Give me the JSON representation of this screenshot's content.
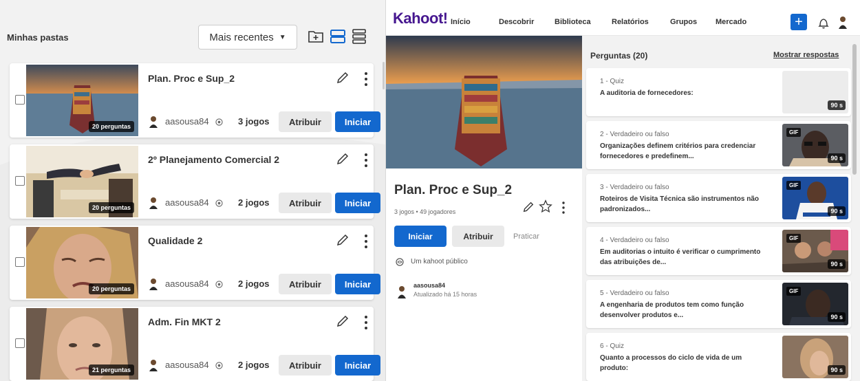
{
  "left": {
    "title": "Minhas pastas",
    "sort_label": "Mais recentes",
    "cards": [
      {
        "title": "Plan. Proc e Sup_2",
        "questions": "20 perguntas",
        "author": "aasousa84",
        "plays": "3 jogos",
        "assign": "Atribuir",
        "start": "Iniciar",
        "thumb": "ship"
      },
      {
        "title": "2º Planejamento Comercial 2",
        "questions": "20 perguntas",
        "author": "aasousa84",
        "plays": "2 jogos",
        "assign": "Atribuir",
        "start": "Iniciar",
        "thumb": "handshake"
      },
      {
        "title": "Qualidade 2",
        "questions": "20 perguntas",
        "author": "aasousa84",
        "plays": "2 jogos",
        "assign": "Atribuir",
        "start": "Iniciar",
        "thumb": "woman-crying"
      },
      {
        "title": "Adm. Fin MKT 2",
        "questions": "21 perguntas",
        "author": "aasousa84",
        "plays": "2 jogos",
        "assign": "Atribuir",
        "start": "Iniciar",
        "thumb": "woman-face"
      }
    ]
  },
  "nav": {
    "logo": "Kahoot!",
    "links": [
      "Início",
      "Descobrir",
      "Biblioteca",
      "Relatórios",
      "Grupos",
      "Mercado"
    ],
    "plus": "+"
  },
  "detail": {
    "title": "Plan. Proc e Sup_2",
    "meta": "3 jogos • 49 jogadores",
    "start": "Iniciar",
    "assign": "Atribuir",
    "practice": "Praticar",
    "visibility": "Um kahoot público",
    "creator": "aasousa84",
    "updated": "Atualizado há 15 horas"
  },
  "questions": {
    "header": "Perguntas (20)",
    "show_answers": "Mostrar respostas",
    "items": [
      {
        "type": "1 - Quiz",
        "text": "A auditoria de fornecedores:",
        "time": "90 s",
        "gif": false,
        "img": "blank"
      },
      {
        "type": "2 - Verdadeiro ou falso",
        "text": "Organizações definem critérios para credenciar fornecedores e predefinem...",
        "time": "90 s",
        "gif": true,
        "gif_label": "GIF",
        "img": "man-glasses"
      },
      {
        "type": "3 - Verdadeiro ou falso",
        "text": "Roteiros de Visita Técnica são instrumentos não padronizados...",
        "time": "90 s",
        "gif": true,
        "gif_label": "GIF",
        "img": "basketball"
      },
      {
        "type": "4 - Verdadeiro ou falso",
        "text": "Em auditorias o intuito é verificar o cumprimento das atribuições de...",
        "time": "90 s",
        "gif": true,
        "gif_label": "GIF",
        "img": "crowd"
      },
      {
        "type": "5 - Verdadeiro ou falso",
        "text": "A engenharia de produtos tem como função desenvolver produtos e...",
        "time": "90 s",
        "gif": true,
        "gif_label": "GIF",
        "img": "dark-man"
      },
      {
        "type": "6 - Quiz",
        "text": "Quanto a processos do ciclo de vida de um produto:",
        "time": "90 s",
        "gif": false,
        "img": "woman-hair"
      }
    ]
  },
  "colors": {
    "primary": "#1368ce",
    "brand": "#46178f",
    "panel_bg": "#f2f2f2"
  }
}
